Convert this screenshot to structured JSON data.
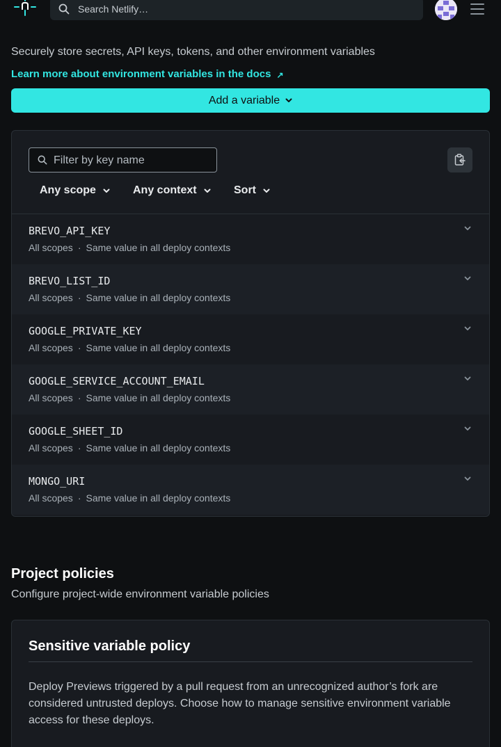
{
  "header": {
    "search_placeholder": "Search Netlify…",
    "icons": [
      "netlify-logo",
      "search-icon",
      "avatar",
      "menu-icon"
    ]
  },
  "env_vars": {
    "description": "Securely store secrets, API keys, tokens, and other environment variables",
    "docs_link": "Learn more about environment variables in the docs",
    "docs_link_arrow": "↗",
    "add_button": "Add a variable",
    "filter_placeholder": "Filter by key name",
    "filters": {
      "scope": "Any scope",
      "context": "Any context",
      "sort": "Sort"
    },
    "variables": [
      {
        "key": "BREVO_API_KEY",
        "scope": "All scopes",
        "context": "Same value in all deploy contexts"
      },
      {
        "key": "BREVO_LIST_ID",
        "scope": "All scopes",
        "context": "Same value in all deploy contexts"
      },
      {
        "key": "GOOGLE_PRIVATE_KEY",
        "scope": "All scopes",
        "context": "Same value in all deploy contexts"
      },
      {
        "key": "GOOGLE_SERVICE_ACCOUNT_EMAIL",
        "scope": "All scopes",
        "context": "Same value in all deploy contexts"
      },
      {
        "key": "GOOGLE_SHEET_ID",
        "scope": "All scopes",
        "context": "Same value in all deploy contexts"
      },
      {
        "key": "MONGO_URI",
        "scope": "All scopes",
        "context": "Same value in all deploy contexts"
      }
    ]
  },
  "project_policies": {
    "title": "Project policies",
    "description": "Configure project-wide environment variable policies",
    "policy_title": "Sensitive variable policy",
    "policy_text": "Deploy Previews triggered by a pull request from an unrecognized author’s fork are considered untrusted deploys. Choose how to manage sensitive environment variable access for these deploys."
  },
  "colors": {
    "background": "#0e1012",
    "accent": "#32e6e2",
    "panel": "#181b20"
  }
}
